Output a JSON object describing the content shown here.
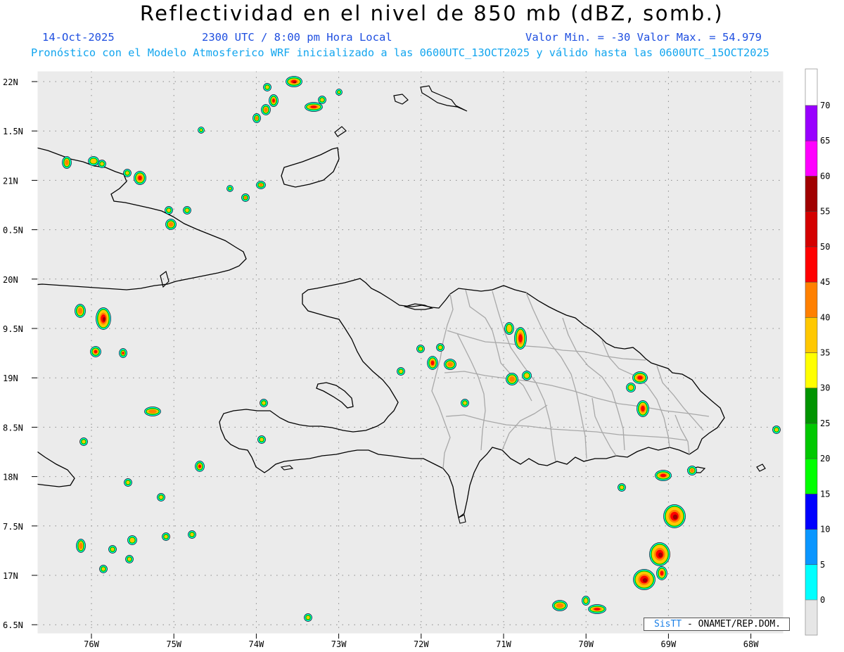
{
  "header": {
    "title": "Reflectividad en el nivel de 850 mb (dBZ, somb.)",
    "date": "14-Oct-2025",
    "time": "2300 UTC / 8:00 pm Hora Local",
    "min_max": "Valor Min. = -30  Valor Max. = 54.979",
    "model_info": "Pronóstico con el Modelo Atmosferico WRF inicializado a las 0600UTC_13OCT2025 y válido hasta las  0600UTC_15OCT2025"
  },
  "map": {
    "lat_labels": [
      "22N",
      "1.5N",
      "21N",
      "0.5N",
      "20N",
      "9.5N",
      "19N",
      "8.5N",
      "18N",
      "7.5N",
      "17N",
      "6.5N"
    ],
    "lon_labels": [
      "76W",
      "75W",
      "74W",
      "73W",
      "72W",
      "71W",
      "70W",
      "69W",
      "68W"
    ],
    "extent": {
      "lon": [
        -76.65,
        -67.6
      ],
      "lat": [
        16.45,
        22.1
      ]
    },
    "background_color": "#ebebeb",
    "coast_color": "#000000",
    "province_color": "#a8a8a8"
  },
  "colorbar": {
    "ticks": [
      "0",
      "5",
      "10",
      "15",
      "20",
      "25",
      "30",
      "35",
      "40",
      "45",
      "50",
      "55",
      "60",
      "65",
      "70"
    ],
    "colors": [
      "#00ffff",
      "#0a96ff",
      "#0000ff",
      "#00ff00",
      "#00c800",
      "#009400",
      "#ffff00",
      "#ffc800",
      "#ff8000",
      "#ff0000",
      "#d40000",
      "#a00000",
      "#ff00ff",
      "#9900ff"
    ]
  },
  "credit": {
    "logo": "SisTT",
    "text": "- ONAMET/REP.DOM."
  }
}
